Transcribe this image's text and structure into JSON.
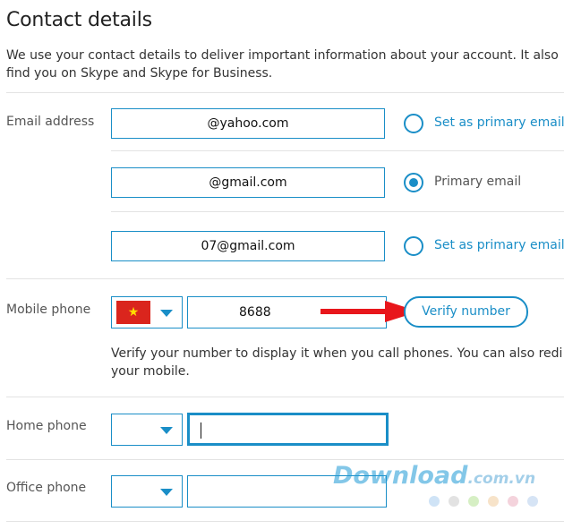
{
  "page": {
    "title": "Contact details",
    "intro_line1": "We use your contact details to deliver important information about your account. It also",
    "intro_line2": "find you on Skype and Skype for Business."
  },
  "email": {
    "label": "Email address",
    "rows": [
      {
        "value": "@yahoo.com",
        "option": "Set as primary email",
        "selected": false
      },
      {
        "value": "@gmail.com",
        "option": "Primary email",
        "selected": true
      },
      {
        "value": "07@gmail.com",
        "option": "Set as primary email",
        "selected": false
      }
    ]
  },
  "mobile": {
    "label": "Mobile phone",
    "number": "8688",
    "verify_label": "Verify number",
    "help_line1": "Verify your number to display it when you call phones. You can also redi",
    "help_line2": "your mobile."
  },
  "home": {
    "label": "Home phone",
    "number": ""
  },
  "office": {
    "label": "Office phone",
    "number": ""
  },
  "watermark": {
    "text": "Download",
    "suffix": ".com.vn",
    "dot_colors": [
      "#cfe3f6",
      "#e2e2e2",
      "#d6efc4",
      "#f7e3c9",
      "#f4d3dc",
      "#d6e4f5"
    ]
  },
  "colors": {
    "accent": "#1a8ec7",
    "arrow": "#e8161b",
    "flag_red": "#da251d",
    "flag_star": "#ffde00"
  },
  "icons": {
    "flag": "vietnam-flag-icon",
    "dropdown": "chevron-down-icon",
    "arrow": "red-arrow-annotation"
  }
}
